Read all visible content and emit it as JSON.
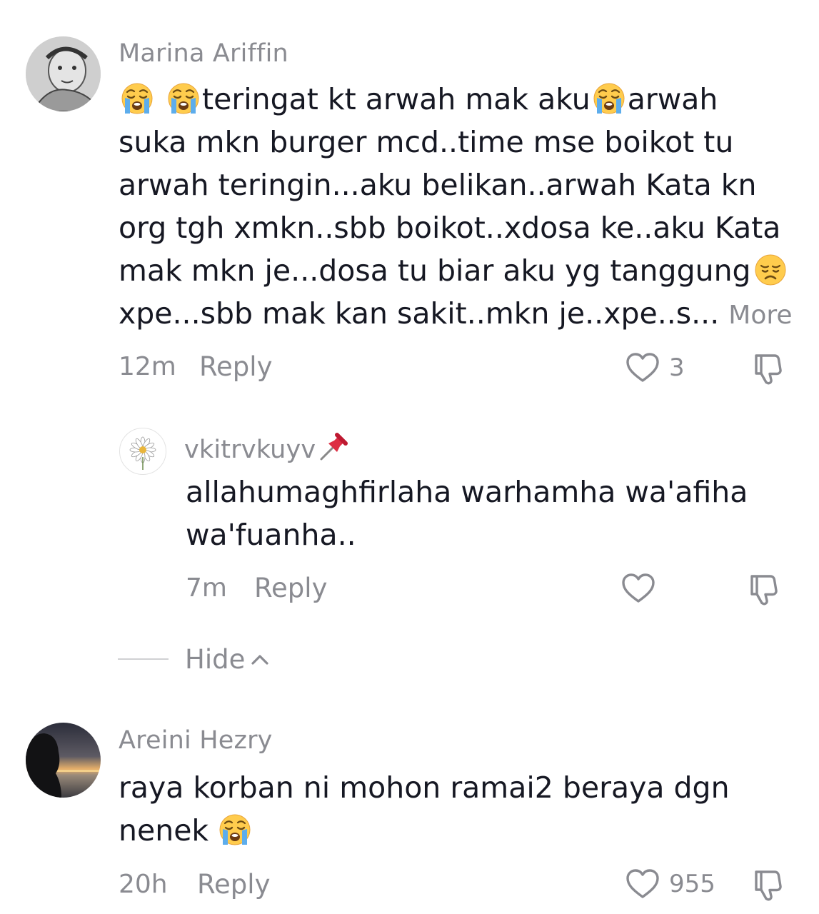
{
  "comments": [
    {
      "username": "Marina Ariffin",
      "lines": [
        [
          "😭 😭",
          "teringat kt arwah mak aku",
          "😭",
          "arwah"
        ],
        "suka mkn burger mcd..time mse boikot tu",
        "arwah teringin...aku belikan..arwah Kata kn",
        "org tgh xmkn..sbb boikot..xdosa ke..aku Kata",
        [
          "mak mkn je...dosa tu biar aku yg tanggung",
          "😞"
        ],
        [
          "xpe...sbb mak kan sakit..mkn je..xpe..s...",
          "More"
        ]
      ],
      "time": "12m",
      "reply_label": "Reply",
      "like_count": "3"
    },
    {
      "username": "vkitrvkuyv",
      "username_emoji": "📌",
      "lines": [
        "allahumaghfirlaha warhamha wa'afiha",
        "wa'fuanha.."
      ],
      "time": "7m",
      "reply_label": "Reply",
      "like_count": ""
    },
    {
      "username": "Areini Hezry",
      "lines": [
        "raya korban ni mohon ramai2 beraya dgn",
        [
          "nenek",
          "😭"
        ]
      ],
      "time": "20h",
      "reply_label": "Reply",
      "like_count": "955"
    }
  ],
  "hide_label": "Hide",
  "icons": {
    "like": "heart-outline-icon",
    "dislike": "thumbs-down-icon",
    "collapse": "chevron-up-icon",
    "crying": "loudly-crying-face-emoji",
    "disappointed": "disappointed-face-emoji",
    "pin": "pushpin-emoji"
  },
  "colors": {
    "text": "#161823",
    "muted": "#8a8b91",
    "background": "#ffffff"
  }
}
